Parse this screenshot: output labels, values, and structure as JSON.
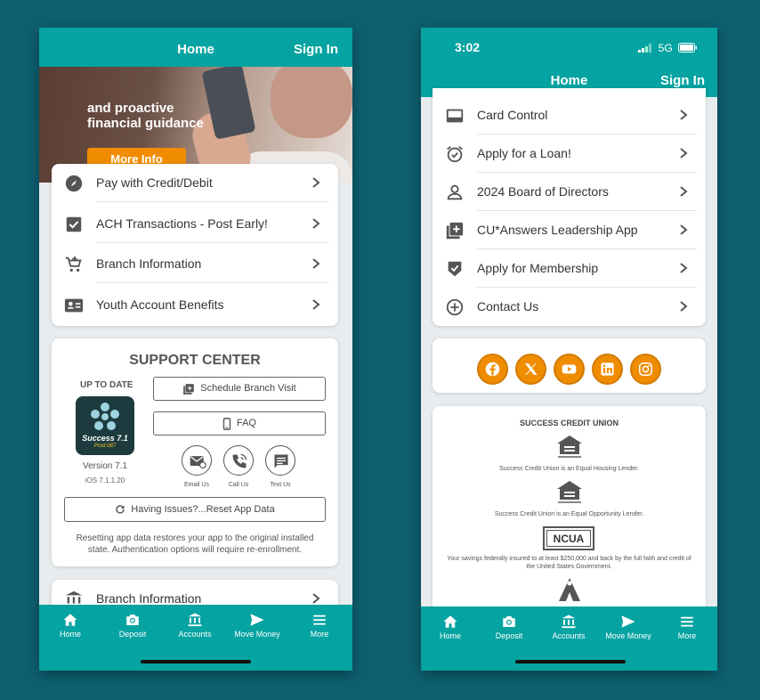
{
  "left": {
    "navbar": {
      "title": "Home",
      "signin": "Sign In"
    },
    "hero": {
      "line1": "and proactive",
      "line2": "financial guidance",
      "button": "More Info"
    },
    "menu": [
      {
        "label": "Pay with Credit/Debit",
        "icon": "compass-icon"
      },
      {
        "label": "ACH Transactions - Post Early!",
        "icon": "checkbox-icon"
      },
      {
        "label": "Branch Information",
        "icon": "cart-icon"
      },
      {
        "label": "Youth Account Benefits",
        "icon": "id-card-icon"
      }
    ],
    "support": {
      "title": "SUPPORT CENTER",
      "up_to_date": "UP TO DATE",
      "logo_name": "Success 7.1",
      "logo_prod": "Prod 087",
      "version": "Version 7.1",
      "ios": "iOS 7.1.1.20",
      "schedule": "Schedule Branch Visit",
      "faq": "FAQ",
      "email": "Email Us",
      "call": "Call Us",
      "text": "Text Us",
      "reset": "Having Issues?...Reset App Data",
      "note": "Resetting app data restores your app to the original installed state. Authentication options will require re-enrollment."
    },
    "partial_row": "Branch Information"
  },
  "right": {
    "status": {
      "time": "3:02",
      "network": "5G"
    },
    "navbar": {
      "title": "Home",
      "signin": "Sign In"
    },
    "menu": [
      {
        "label": "Card Control",
        "icon": "card-icon"
      },
      {
        "label": "Apply for a Loan!",
        "icon": "alarm-icon"
      },
      {
        "label": "2024 Board of Directors",
        "icon": "person-icon"
      },
      {
        "label": "CU*Answers Leadership App",
        "icon": "add-box-icon"
      },
      {
        "label": "Apply for Membership",
        "icon": "shield-check-icon"
      },
      {
        "label": "Contact Us",
        "icon": "plus-circle-icon"
      }
    ],
    "social": [
      "facebook-icon",
      "x-icon",
      "youtube-icon",
      "linkedin-icon",
      "instagram-icon"
    ],
    "disclosures": {
      "title": "SUCCESS CREDIT UNION",
      "housing": "Success Credit Union is an Equal Housing Lender.",
      "opportunity": "Success Credit Union is an Equal Opportunity Lender.",
      "ncua_logo": "NCUA",
      "ncua_text": "Your savings federally insured to at least $250,000 and back by the full faith and credit of the United States Government."
    }
  },
  "tabs": [
    {
      "label": "Home",
      "icon": "home-icon"
    },
    {
      "label": "Deposit",
      "icon": "camera-icon"
    },
    {
      "label": "Accounts",
      "icon": "bank-icon"
    },
    {
      "label": "Move Money",
      "icon": "send-icon"
    },
    {
      "label": "More",
      "icon": "menu-icon"
    }
  ],
  "colors": {
    "teal": "#05a3a1",
    "orange": "#f08c00",
    "background": "#0e5f70"
  }
}
